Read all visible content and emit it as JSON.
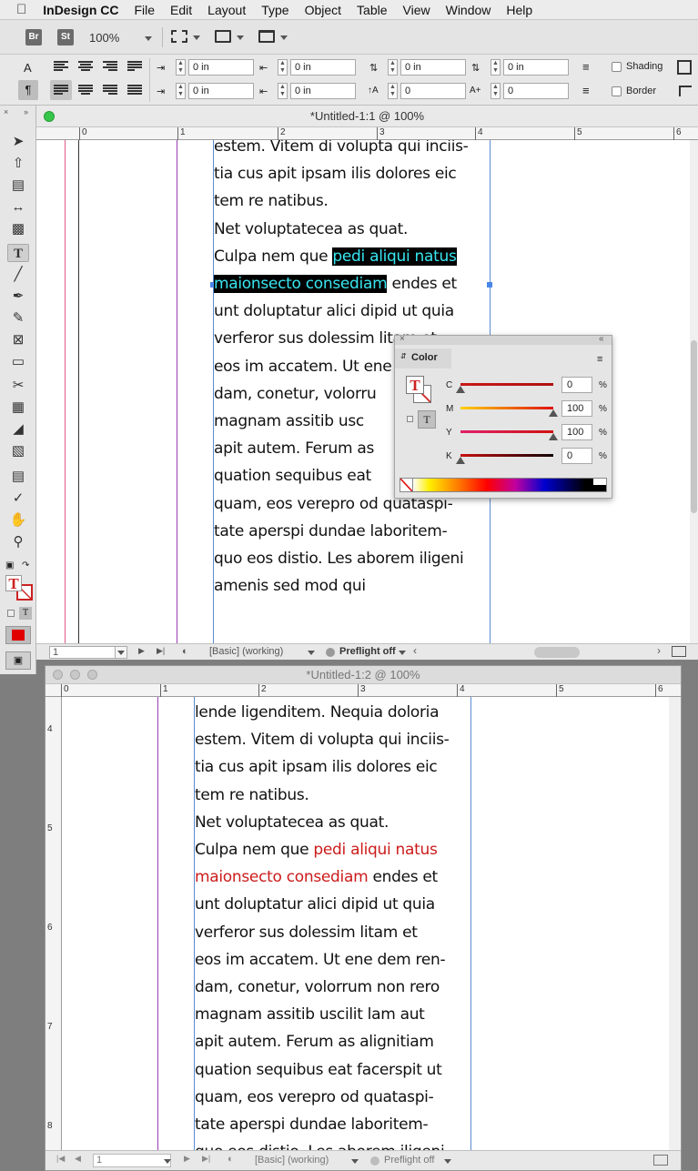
{
  "menubar": {
    "apple": "",
    "items": [
      "InDesign CC",
      "File",
      "Edit",
      "Layout",
      "Type",
      "Object",
      "Table",
      "View",
      "Window",
      "Help"
    ]
  },
  "appbar": {
    "bridge": "Br",
    "stock": "St",
    "zoom": "100%"
  },
  "control": {
    "fields_row1": [
      "0 in",
      "0 in",
      "0 in",
      "0 in"
    ],
    "fields_row2": [
      "0 in",
      "0 in",
      "0",
      "0"
    ],
    "shading_label": "Shading",
    "border_label": "Border"
  },
  "doc1": {
    "title": "*Untitled-1:1 @ 100%",
    "ruler": [
      "0",
      "1",
      "2",
      "3",
      "4",
      "5",
      "6"
    ],
    "lines": [
      {
        "pre": "estem. Vitem di volupta qui inciis-",
        "hl": "",
        "post": ""
      },
      {
        "pre": "tia cus apit ipsam ilis dolores eic",
        "hl": "",
        "post": ""
      },
      {
        "pre": "tem re natibus.",
        "hl": "",
        "post": ""
      },
      {
        "pre": "Net voluptatecea as quat.",
        "hl": "",
        "post": ""
      },
      {
        "pre": "Culpa nem que ",
        "hl": "pedi aliqui natus",
        "post": ""
      },
      {
        "pre": "",
        "hl": "maionsecto consediam",
        "post": " endes et"
      },
      {
        "pre": "unt doluptatur alici dipid ut quia",
        "hl": "",
        "post": ""
      },
      {
        "pre": "verferor sus dolessim litam et",
        "hl": "",
        "post": ""
      },
      {
        "pre": "eos im accatem. Ut ene",
        "hl": "",
        "post": ""
      },
      {
        "pre": "dam, conetur, volorru",
        "hl": "",
        "post": ""
      },
      {
        "pre": "magnam assitib usc",
        "hl": "",
        "post": ""
      },
      {
        "pre": "apit autem. Ferum as",
        "hl": "",
        "post": ""
      },
      {
        "pre": "quation sequibus eat",
        "hl": "",
        "post": ""
      },
      {
        "pre": "quam, eos verepro od quataspi-",
        "hl": "",
        "post": ""
      },
      {
        "pre": "tate aperspi dundae laboritem-",
        "hl": "",
        "post": ""
      },
      {
        "pre": "quo eos distio. Les aborem iligeni",
        "hl": "",
        "post": ""
      },
      {
        "pre": "amenis sed mod qui",
        "hl": "",
        "post": ""
      }
    ],
    "page_number": "1",
    "style": "[Basic] (working)",
    "preflight": "Preflight off"
  },
  "color_panel": {
    "title": "Color",
    "channels": [
      {
        "label": "C",
        "value": "0",
        "pct": "%",
        "level": 0
      },
      {
        "label": "M",
        "value": "100",
        "pct": "%",
        "level": 1
      },
      {
        "label": "Y",
        "value": "100",
        "pct": "%",
        "level": 1
      },
      {
        "label": "K",
        "value": "0",
        "pct": "%",
        "level": 0
      }
    ],
    "text_icon": "T",
    "colors": {
      "red": "#cc1b1b",
      "cyan": "#39e6f0"
    }
  },
  "doc2": {
    "title": "*Untitled-1:2 @ 100%",
    "ruler": [
      "0",
      "1",
      "2",
      "3",
      "4",
      "5",
      "6"
    ],
    "vruler": [
      "4",
      "5",
      "6",
      "7",
      "8"
    ],
    "lines": [
      {
        "pre": "lende ligenditem. Nequia doloria",
        "red": "",
        "post": ""
      },
      {
        "pre": "estem. Vitem di volupta qui inciis-",
        "red": "",
        "post": ""
      },
      {
        "pre": "tia cus apit ipsam ilis dolores eic",
        "red": "",
        "post": ""
      },
      {
        "pre": "tem re natibus.",
        "red": "",
        "post": ""
      },
      {
        "pre": "Net voluptatecea as quat.",
        "red": "",
        "post": ""
      },
      {
        "pre": "Culpa nem que ",
        "red": "pedi aliqui natus",
        "post": ""
      },
      {
        "pre": "",
        "red": "maionsecto consediam",
        "post": " endes et"
      },
      {
        "pre": "unt doluptatur alici dipid ut quia",
        "red": "",
        "post": ""
      },
      {
        "pre": "verferor sus dolessim litam et",
        "red": "",
        "post": ""
      },
      {
        "pre": "eos im accatem. Ut ene dem ren-",
        "red": "",
        "post": ""
      },
      {
        "pre": "dam, conetur, volorrum non rero",
        "red": "",
        "post": ""
      },
      {
        "pre": "magnam assitib uscilit lam aut",
        "red": "",
        "post": ""
      },
      {
        "pre": "apit autem. Ferum as alignitiam",
        "red": "",
        "post": ""
      },
      {
        "pre": "quation sequibus eat facerspit ut",
        "red": "",
        "post": ""
      },
      {
        "pre": "quam, eos verepro od quataspi-",
        "red": "",
        "post": ""
      },
      {
        "pre": "tate aperspi dundae laboritem-",
        "red": "",
        "post": ""
      },
      {
        "pre": "quo eos distio. Les aborem iligeni",
        "red": "",
        "post": ""
      }
    ],
    "page_number": "1",
    "style": "[Basic] (working)",
    "preflight": "Preflight off"
  }
}
